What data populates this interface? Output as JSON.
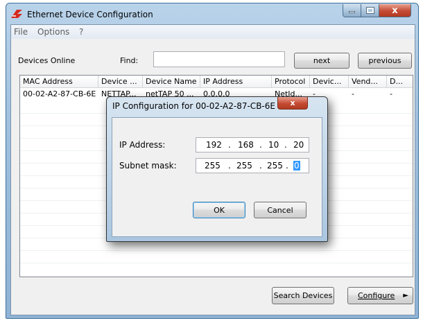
{
  "window": {
    "title": "Ethernet Device Configuration"
  },
  "menu": {
    "items": [
      "File",
      "Options",
      "?"
    ]
  },
  "toolbar": {
    "devices_online_label": "Devices Online",
    "find_label": "Find:",
    "find_value": "",
    "next_label": "next",
    "previous_label": "previous"
  },
  "table": {
    "columns": [
      "MAC Address",
      "Device ...",
      "Device Name",
      "IP Address",
      "Protocol",
      "Devic...",
      "Vend...",
      "D..."
    ],
    "rows": [
      [
        "00-02-A2-87-CB-6E",
        "NETTAP...",
        "netTAP 50 ...",
        "0.0.0.0",
        "NetId...",
        "-",
        "-",
        "-"
      ]
    ]
  },
  "footer": {
    "search_label": "Search Devices",
    "configure_label": "Configure",
    "configure_arrow": "►"
  },
  "dialog": {
    "title": "IP Configuration for  00-02-A2-87-CB-6E",
    "close_glyph": "x",
    "ip_label": "IP Address:",
    "ip_octets": [
      "192",
      "168",
      "10",
      "20"
    ],
    "subnet_label": "Subnet mask:",
    "subnet_octets": [
      "255",
      "255",
      "255",
      "0"
    ],
    "separator": ".",
    "ok_label": "OK",
    "cancel_label": "Cancel"
  },
  "colors": {
    "title_gradient_top": "#b9d3ea",
    "close_button": "#c44b33",
    "selection": "#3399ff"
  },
  "icons": [
    "app-logo-icon",
    "minimize-icon",
    "maximize-icon",
    "close-icon",
    "arrow-right-icon"
  ]
}
